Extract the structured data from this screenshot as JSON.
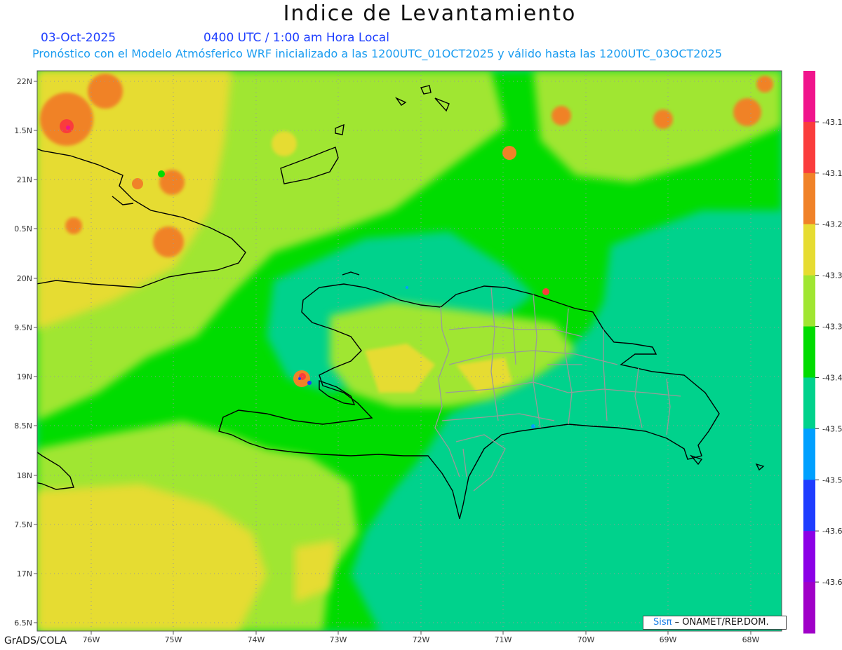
{
  "header": {
    "title": "Indice de Levantamiento",
    "date": "03-Oct-2025",
    "time": "0400 UTC / 1:00 am Hora Local",
    "model_line": "Pronóstico con el Modelo Atmósferico WRF inicializado a las 1200UTC_01OCT2025 y válido hasta las  1200UTC_03OCT2025"
  },
  "axes": {
    "lat_labels": [
      "22N",
      "1.5N",
      "21N",
      "0.5N",
      "20N",
      "9.5N",
      "19N",
      "8.5N",
      "18N",
      "7.5N",
      "17N",
      "6.5N"
    ],
    "lon_labels": [
      "76W",
      "75W",
      "74W",
      "73W",
      "72W",
      "71W",
      "70W",
      "69W",
      "68W"
    ]
  },
  "colorbar": {
    "colors": [
      "#f0148c",
      "#fa3c3c",
      "#f08228",
      "#e6dc32",
      "#a0e632",
      "#00dc00",
      "#00d28c",
      "#00a0ff",
      "#1e3cff",
      "#8c00e6",
      "#a000c8"
    ],
    "labels": [
      "-43.1",
      "-43.1",
      "-43.2",
      "-43.3",
      "-43.3",
      "-43.4",
      "-43.5",
      "-43.5",
      "-43.6",
      "-43.6"
    ]
  },
  "credit": {
    "sis": "Sisπ",
    "org": "– ONAMET/REP.DOM."
  },
  "footer": {
    "software": "GrADS/COLA"
  }
}
